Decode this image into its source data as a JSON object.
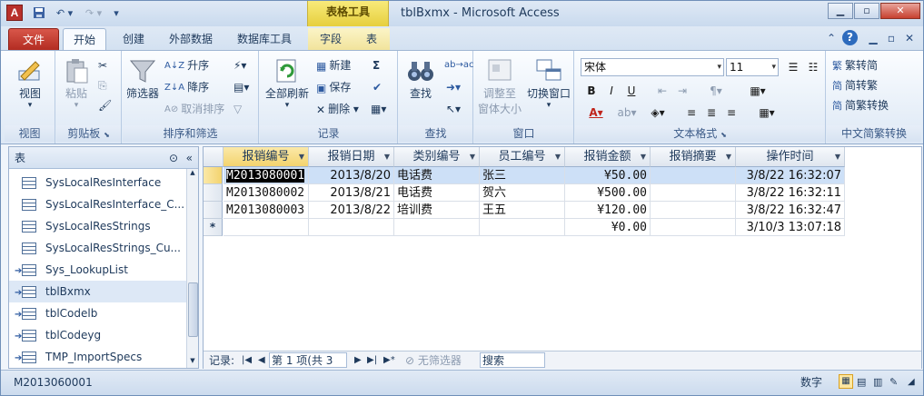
{
  "window": {
    "title": "tblBxmx - Microsoft Access",
    "context_tab_group": "表格工具",
    "app_letter": "A"
  },
  "tabs": [
    {
      "label": "文件"
    },
    {
      "label": "开始"
    },
    {
      "label": "创建"
    },
    {
      "label": "外部数据"
    },
    {
      "label": "数据库工具"
    },
    {
      "label": "字段"
    },
    {
      "label": "表"
    }
  ],
  "ribbon": {
    "groups": {
      "views": "视图",
      "clipboard": "剪贴板",
      "sort_filter": "排序和筛选",
      "records": "记录",
      "find": "查找",
      "window": "窗口",
      "text_format": "文本格式",
      "convert": "中文简繁转换"
    },
    "view_button": "视图",
    "paste_button": "粘贴",
    "filter_button": "筛选器",
    "ascending": "升序",
    "descending": "降序",
    "clear_sort": "取消排序",
    "refresh_all": "全部刷新",
    "new_record": "新建",
    "save_record": "保存",
    "delete_record": "删除",
    "find_button": "查找",
    "fit_window_line1": "调整至",
    "fit_window_line2": "窗体大小",
    "switch_window": "切换窗口",
    "font_name": "宋体",
    "font_size": "11",
    "to_simplified": "繁转简",
    "to_traditional": "简转繁",
    "convert_simp_trad": "简繁转换"
  },
  "nav_pane": {
    "title": "表",
    "items": [
      {
        "name": "SysLocalResInterface",
        "linked": false
      },
      {
        "name": "SysLocalResInterface_C...",
        "linked": false
      },
      {
        "name": "SysLocalResStrings",
        "linked": false
      },
      {
        "name": "SysLocalResStrings_Cu...",
        "linked": false
      },
      {
        "name": "Sys_LookupList",
        "linked": true
      },
      {
        "name": "tblBxmx",
        "linked": true,
        "selected": true
      },
      {
        "name": "tblCodelb",
        "linked": true
      },
      {
        "name": "tblCodeyg",
        "linked": true
      },
      {
        "name": "TMP_ImportSpecs",
        "linked": false
      }
    ]
  },
  "datasheet": {
    "columns": [
      "报销编号",
      "报销日期",
      "类别编号",
      "员工编号",
      "报销金额",
      "报销摘要",
      "操作时间"
    ],
    "rows": [
      [
        "M2013080001",
        "2013/8/20",
        "电话费",
        "张三",
        "¥50.00",
        "",
        "3/8/22 16:32:07"
      ],
      [
        "M2013080002",
        "2013/8/21",
        "电话费",
        "贺六",
        "¥500.00",
        "",
        "3/8/22 16:32:11"
      ],
      [
        "M2013080003",
        "2013/8/22",
        "培训费",
        "王五",
        "¥120.00",
        "",
        "3/8/22 16:32:47"
      ]
    ],
    "new_row": [
      "",
      "",
      "",
      "",
      "¥0.00",
      "",
      "3/10/3 13:07:18"
    ],
    "new_row_marker": "*"
  },
  "record_nav": {
    "label": "记录:",
    "position": "第 1 项(共 3 项)",
    "filter": "无筛选器",
    "search": "搜索"
  },
  "status_bar": {
    "left": "M2013060001",
    "mode": "数字"
  }
}
